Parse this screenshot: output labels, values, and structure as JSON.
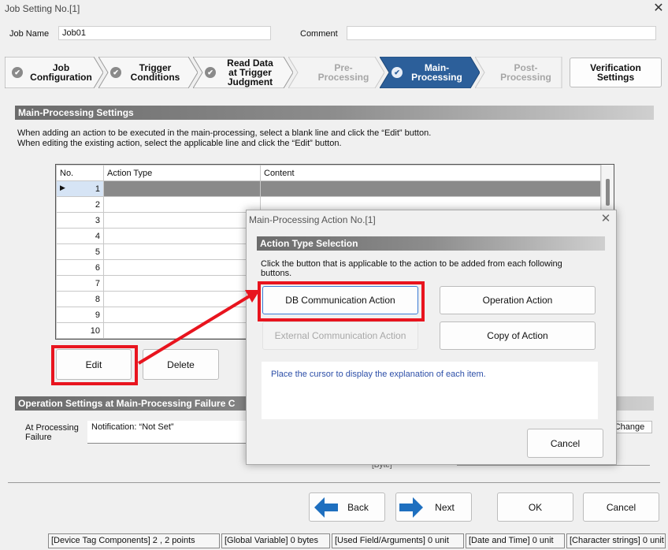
{
  "window": {
    "title": "Job Setting No.[1]"
  },
  "header": {
    "job_name_label": "Job Name",
    "job_name_value": "Job01",
    "comment_label": "Comment",
    "comment_value": ""
  },
  "steps": [
    {
      "label": "Job\nConfiguration",
      "state": "done"
    },
    {
      "label": "Trigger\nConditions",
      "state": "done"
    },
    {
      "label": "Read Data\nat Trigger\nJudgment",
      "state": "done"
    },
    {
      "label": "Pre-\nProcessing",
      "state": "disabled"
    },
    {
      "label": "Main-\nProcessing",
      "state": "active"
    },
    {
      "label": "Post-\nProcessing",
      "state": "disabled"
    }
  ],
  "verification_button": "Verification\nSettings",
  "main_settings": {
    "title": "Main-Processing Settings",
    "desc1": "When adding an action to be executed in the main-processing, select a blank line and click the “Edit” button.",
    "desc2": "When editing the existing action, select the applicable line and click the “Edit” button.",
    "columns": [
      "No.",
      "Action Type",
      "Content"
    ],
    "rows": [
      "1",
      "2",
      "3",
      "4",
      "5",
      "6",
      "7",
      "8",
      "9",
      "10"
    ],
    "edit_label": "Edit",
    "delete_label": "Delete"
  },
  "failure_settings": {
    "title": "Operation Settings at Main-Processing Failure C",
    "at_failure_label": "At Processing\nFailure",
    "notification_value": "Notification: “Not Set”",
    "change_label": "Change",
    "bytes_label": "[Byte]"
  },
  "footer": {
    "back": "Back",
    "next": "Next",
    "ok": "OK",
    "cancel": "Cancel"
  },
  "status_bar": [
    "[Device Tag Components]  2 ,   2 points",
    "[Global Variable]  0 bytes",
    "[Used Field/Arguments]  0 unit",
    "[Date and Time]  0 unit",
    "[Character strings]  0 unit"
  ],
  "dialog": {
    "title": "Main-Processing Action No.[1]",
    "section_title": "Action Type Selection",
    "instruction": "Click the button that is applicable to the action to be added from each following buttons.",
    "db_button": "DB Communication Action",
    "operation_button": "Operation Action",
    "external_button": "External Communication Action",
    "copy_button": "Copy of Action",
    "explanation": "Place the cursor to display the explanation of each item.",
    "cancel": "Cancel"
  },
  "colors": {
    "active_step": "#2c5f9a",
    "highlight": "#e8141e",
    "arrow_blue": "#1e6fbf",
    "explain_text": "#2d4fa8"
  }
}
